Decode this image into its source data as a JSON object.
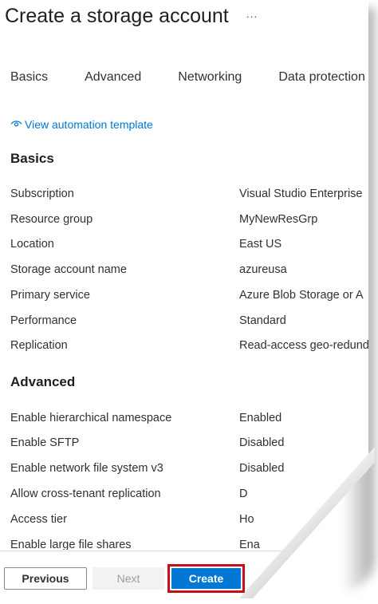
{
  "header": {
    "title": "Create a storage account",
    "more_label": "..."
  },
  "tabs": [
    {
      "label": "Basics"
    },
    {
      "label": "Advanced"
    },
    {
      "label": "Networking"
    },
    {
      "label": "Data protection"
    }
  ],
  "automation_link": {
    "label": "View automation template",
    "icon": "eye-icon"
  },
  "sections": [
    {
      "title": "Basics",
      "rows": [
        {
          "label": "Subscription",
          "value": "Visual Studio Enterprise"
        },
        {
          "label": "Resource group",
          "value": "MyNewResGrp"
        },
        {
          "label": "Location",
          "value": "East US"
        },
        {
          "label": "Storage account name",
          "value": "azureusa"
        },
        {
          "label": "Primary service",
          "value": "Azure Blob Storage or A"
        },
        {
          "label": "Performance",
          "value": "Standard"
        },
        {
          "label": "Replication",
          "value": "Read-access geo-redund"
        }
      ]
    },
    {
      "title": "Advanced",
      "rows": [
        {
          "label": "Enable hierarchical namespace",
          "value": "Enabled"
        },
        {
          "label": "Enable SFTP",
          "value": "Disabled"
        },
        {
          "label": "Enable network file system v3",
          "value": "Disabled"
        },
        {
          "label": "Allow cross-tenant replication",
          "value": "D"
        },
        {
          "label": "Access tier",
          "value": "Ho"
        },
        {
          "label": "Enable large file shares",
          "value": "Ena"
        }
      ]
    }
  ],
  "footer": {
    "previous_label": "Previous",
    "next_label": "Next",
    "create_label": "Create"
  },
  "colors": {
    "accent": "#0078d4",
    "highlight_border": "#c50f1f"
  }
}
